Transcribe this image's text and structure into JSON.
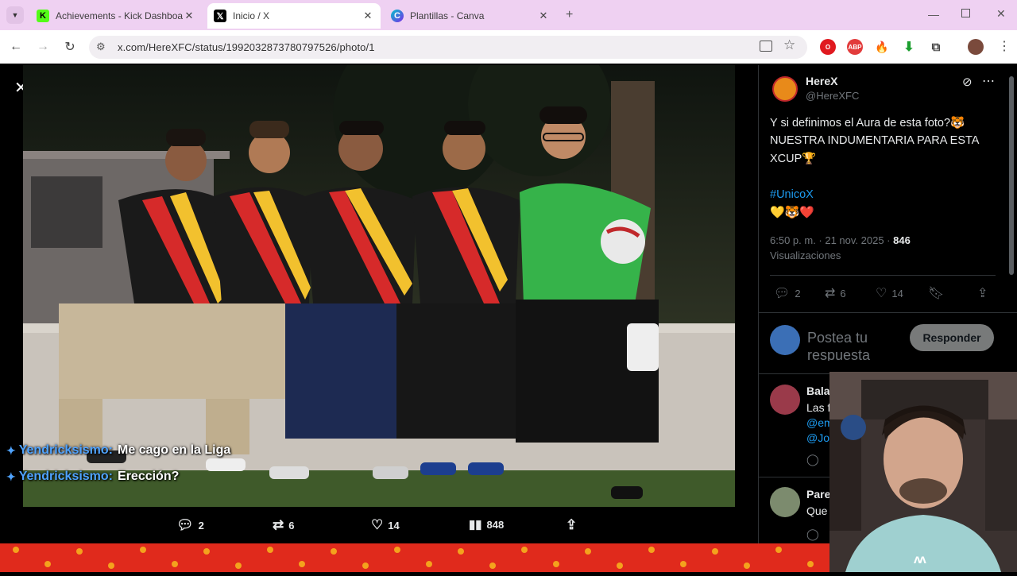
{
  "tabs": [
    {
      "title": "Achievements - Kick Dashboard",
      "active": false
    },
    {
      "title": "Inicio / X",
      "active": true
    },
    {
      "title": "Plantillas - Canva",
      "active": false
    }
  ],
  "toolbar": {
    "url": "x.com/HereXFC/status/1992032873780797526/photo/1"
  },
  "media": {
    "actions": {
      "replies": "2",
      "reposts": "6",
      "likes": "14",
      "views": "848"
    }
  },
  "chat": [
    {
      "user": "Yendricksismo:",
      "message": "Me cago en la Liga"
    },
    {
      "user": "Yendricksismo:",
      "message": "Erección?"
    }
  ],
  "tweet": {
    "author_name": "HereX",
    "author_handle": "@HereXFC",
    "text_line1": "Y si definimos el Aura de esta foto?🐯",
    "text_line2": "NUESTRA INDUMENTARIA PARA ESTA",
    "text_line3": "XCUP🏆",
    "hashtag": "#UnicoX",
    "emojis": "💛🐯❤️",
    "time": "6:50 p. m. · 21 nov. 2025 · ",
    "views": "846",
    "views_label": "Visualizaciones",
    "replies": "2",
    "reposts": "6",
    "likes": "14"
  },
  "reply_box": {
    "placeholder": "Postea tu respuesta",
    "button": "Responder"
  },
  "replies": [
    {
      "name": "Bala",
      "line1": "Las f",
      "line2": "@em",
      "line3": "@Jos"
    },
    {
      "name": "Pare",
      "line1": "Que"
    }
  ],
  "cam_logo": "ʌʌ"
}
